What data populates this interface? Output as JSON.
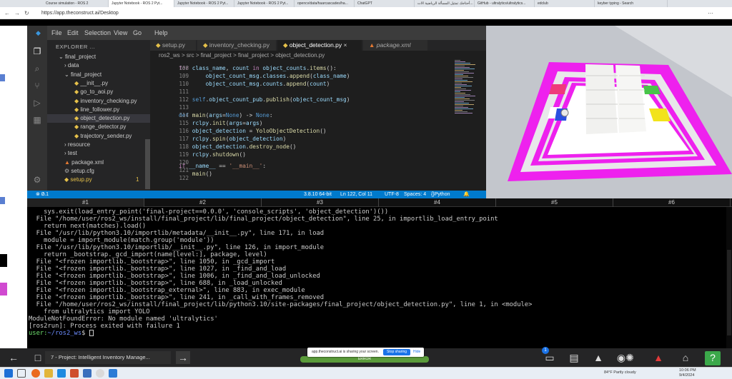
{
  "browser": {
    "tabs": [
      {
        "label": "Course simulation - ROS 2"
      },
      {
        "label": "Jupyter Notebook - ROS 2 Pyt..."
      },
      {
        "label": "Jupyter Notebook - ROS 2 Pyt..."
      },
      {
        "label": "Jupyter Notebook - ROS 2 Pyt..."
      },
      {
        "label": "opencv/data/haarcascades/ha..."
      },
      {
        "label": "ChatGPT"
      },
      {
        "label": "أحتاجك تمثيل المسألة الرياضية الات..."
      },
      {
        "label": "GitHub - ultralytics/ultralytics..."
      },
      {
        "label": "edclub"
      },
      {
        "label": "keyber typing - Search"
      }
    ],
    "url": "https://app.theconstruct.ai/Desktop"
  },
  "vscode": {
    "menu": [
      "File",
      "Edit",
      "Selection",
      "View",
      "Go",
      "Help"
    ],
    "explorer_title": "EXPLORER ...",
    "tree": [
      {
        "label": "final_project",
        "chev": "⌄",
        "indent": 16,
        "type": "folder"
      },
      {
        "label": "data",
        "chev": "›",
        "indent": 24,
        "type": "folder"
      },
      {
        "label": "final_project",
        "chev": "⌄",
        "indent": 24,
        "type": "folder"
      },
      {
        "label": "__init__.py",
        "chev": "",
        "indent": 38,
        "type": "py"
      },
      {
        "label": "go_to_aoi.py",
        "chev": "",
        "indent": 38,
        "type": "py"
      },
      {
        "label": "inventory_checking.py",
        "chev": "",
        "indent": 38,
        "type": "py"
      },
      {
        "label": "line_follower.py",
        "chev": "",
        "indent": 38,
        "type": "py"
      },
      {
        "label": "object_detection.py",
        "chev": "",
        "indent": 38,
        "type": "py",
        "selected": true
      },
      {
        "label": "range_detector.py",
        "chev": "",
        "indent": 38,
        "type": "py"
      },
      {
        "label": "trajectory_sender.py",
        "chev": "",
        "indent": 38,
        "type": "py"
      },
      {
        "label": "resource",
        "chev": "›",
        "indent": 24,
        "type": "folder"
      },
      {
        "label": "test",
        "chev": "›",
        "indent": 24,
        "type": "folder"
      },
      {
        "label": "package.xml",
        "chev": "",
        "indent": 24,
        "type": "xml"
      },
      {
        "label": "setup.cfg",
        "chev": "",
        "indent": 24,
        "type": "cfg"
      },
      {
        "label": "setup.py",
        "chev": "",
        "indent": 24,
        "type": "py",
        "badge": "1"
      }
    ],
    "editor_tabs": [
      "setup.py",
      "inventory_checking.py",
      "object_detection.py",
      "package.xml"
    ],
    "breadcrumb": [
      "ros2_ws",
      "src",
      "final_project",
      "final_project",
      "object_detection.py"
    ],
    "line_numbers": [
      "108",
      "109",
      "110",
      "111",
      "112",
      "113",
      "114",
      "115",
      "116",
      "117",
      "118",
      "119",
      "120",
      "121",
      "122"
    ],
    "status": {
      "errors": "0",
      "warnings": "1",
      "python_version": "3.8.10 64-bit",
      "position": "Ln 122, Col 11",
      "encoding": "UTF-8",
      "indent": "Spaces: 4",
      "language": "Python"
    }
  },
  "terminal": {
    "tabs": [
      "#1",
      "#2",
      "#3",
      "#4",
      "#5",
      "#6"
    ],
    "lines": [
      "    sys.exit(load_entry_point('final-project==0.0.0', 'console_scripts', 'object_detection')())",
      "  File \"/home/user/ros2_ws/install/final_project/lib/final_project/object_detection\", line 25, in importlib_load_entry_point",
      "    return next(matches).load()",
      "  File \"/usr/lib/python3.10/importlib/metadata/__init__.py\", line 171, in load",
      "    module = import_module(match.group('module'))",
      "  File \"/usr/lib/python3.10/importlib/__init__.py\", line 126, in import_module",
      "    return _bootstrap._gcd_import(name[level:], package, level)",
      "  File \"<frozen importlib._bootstrap>\", line 1050, in _gcd_import",
      "  File \"<frozen importlib._bootstrap>\", line 1027, in _find_and_load",
      "  File \"<frozen importlib._bootstrap>\", line 1006, in _find_and_load_unlocked",
      "  File \"<frozen importlib._bootstrap>\", line 688, in _load_unlocked",
      "  File \"<frozen importlib._bootstrap_external>\", line 883, in exec_module",
      "  File \"<frozen importlib._bootstrap>\", line 241, in _call_with_frames_removed",
      "  File \"/home/user/ros2_ws/install/final_project/lib/python3.10/site-packages/final_project/object_detection.py\", line 1, in <module>",
      "    from ultralytics import YOLO",
      "ModuleNotFoundError: No module named 'ultralytics'",
      "[ros2run]: Process exited with failure 1"
    ],
    "prompt_user": "user:",
    "prompt_path": "~/ros2_ws",
    "prompt_symbol": "$ "
  },
  "bottom": {
    "window_title": "7 - Project: Intelligent Inventory Manage...",
    "notification_count": "1",
    "share_text": "app.theconstruct.ai is sharing your screen.",
    "stop_label": "Stop sharing",
    "hide_label": "Hide",
    "green_label": "ERROR"
  },
  "taskbar": {
    "weather": "84°F  Partly cloudy",
    "time": "10:06 PM",
    "date": "9/4/2024"
  }
}
